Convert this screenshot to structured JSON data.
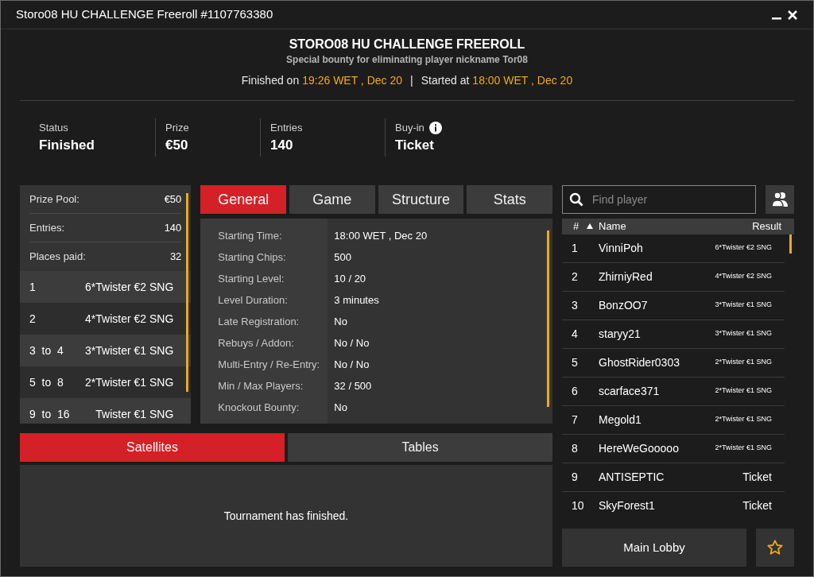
{
  "window": {
    "title": "Storo08 HU CHALLENGE Freeroll #1107763380"
  },
  "header": {
    "title": "STORO08 HU CHALLENGE FREEROLL",
    "subtitle": "Special bounty for eliminating player nickname Tor08",
    "finished_label": "Finished on",
    "finished_time": "19:26 WET , Dec 20",
    "separator": "|",
    "started_label": "Started at",
    "started_time": "18:00 WET , Dec 20"
  },
  "stats": [
    {
      "label": "Status",
      "value": "Finished",
      "info": false
    },
    {
      "label": "Prize",
      "value": "€50",
      "info": false
    },
    {
      "label": "Entries",
      "value": "140",
      "info": false
    },
    {
      "label": "Buy-in",
      "value": "Ticket",
      "info": true
    }
  ],
  "prize_summary": [
    {
      "label": "Prize Pool:",
      "value": "€50"
    },
    {
      "label": "Entries:",
      "value": "140"
    },
    {
      "label": "Places paid:",
      "value": "32"
    }
  ],
  "payouts": [
    {
      "place": "1",
      "prize": "6*Twister €2 SNG"
    },
    {
      "place": "2",
      "prize": "4*Twister €2 SNG"
    },
    {
      "place": "3  to  4",
      "prize": "3*Twister €1 SNG"
    },
    {
      "place": "5  to  8",
      "prize": "2*Twister €1 SNG"
    },
    {
      "place": "9  to  16",
      "prize": "Twister €1 SNG"
    }
  ],
  "info_tabs": [
    {
      "label": "General",
      "selected": true
    },
    {
      "label": "Game",
      "selected": false
    },
    {
      "label": "Structure",
      "selected": false
    },
    {
      "label": "Stats",
      "selected": false
    }
  ],
  "general": [
    {
      "label": "Starting Time:",
      "value": "18:00 WET , Dec 20"
    },
    {
      "label": "Starting Chips:",
      "value": "500"
    },
    {
      "label": "Starting Level:",
      "value": "10 / 20"
    },
    {
      "label": "Level Duration:",
      "value": "3 minutes"
    },
    {
      "label": "Late Registration:",
      "value": "No"
    },
    {
      "label": "Rebuys / Addon:",
      "value": "No / No"
    },
    {
      "label": "Multi-Entry / Re-Entry:",
      "value": "No / No"
    },
    {
      "label": "Min / Max Players:",
      "value": "32 / 500"
    },
    {
      "label": "Knockout Bounty:",
      "value": "No"
    }
  ],
  "bottom_tabs": [
    {
      "label": "Satellites",
      "selected": true
    },
    {
      "label": "Tables",
      "selected": false
    }
  ],
  "bottom_message": "Tournament has finished.",
  "player_search": {
    "placeholder": "Find player"
  },
  "players_table": {
    "columns": [
      {
        "label": "#",
        "sorted": false
      },
      {
        "label": "Name",
        "sorted": true
      },
      {
        "label": "Result",
        "sorted": false
      }
    ],
    "rows": [
      {
        "rank": "1",
        "name": "VinniPoh",
        "result": "6*Twister €2 SNG",
        "kind": "sng"
      },
      {
        "rank": "2",
        "name": "ZhirniyRed",
        "result": "4*Twister €2 SNG",
        "kind": "sng"
      },
      {
        "rank": "3",
        "name": "BonzOO7",
        "result": "3*Twister €1 SNG",
        "kind": "sng"
      },
      {
        "rank": "4",
        "name": "staryy21",
        "result": "3*Twister €1 SNG",
        "kind": "sng"
      },
      {
        "rank": "5",
        "name": "GhostRider0303",
        "result": "2*Twister €1 SNG",
        "kind": "sng"
      },
      {
        "rank": "6",
        "name": "scarface371",
        "result": "2*Twister €1 SNG",
        "kind": "sng"
      },
      {
        "rank": "7",
        "name": "Megold1",
        "result": "2*Twister €1 SNG",
        "kind": "sng"
      },
      {
        "rank": "8",
        "name": "HereWeGooooo",
        "result": "2*Twister €1 SNG",
        "kind": "sng"
      },
      {
        "rank": "9",
        "name": "ANTISEPTIC",
        "result": "Ticket",
        "kind": "ticket"
      },
      {
        "rank": "10",
        "name": "SkyForest1",
        "result": "Ticket",
        "kind": "ticket"
      }
    ]
  },
  "main_lobby_button": "Main Lobby"
}
